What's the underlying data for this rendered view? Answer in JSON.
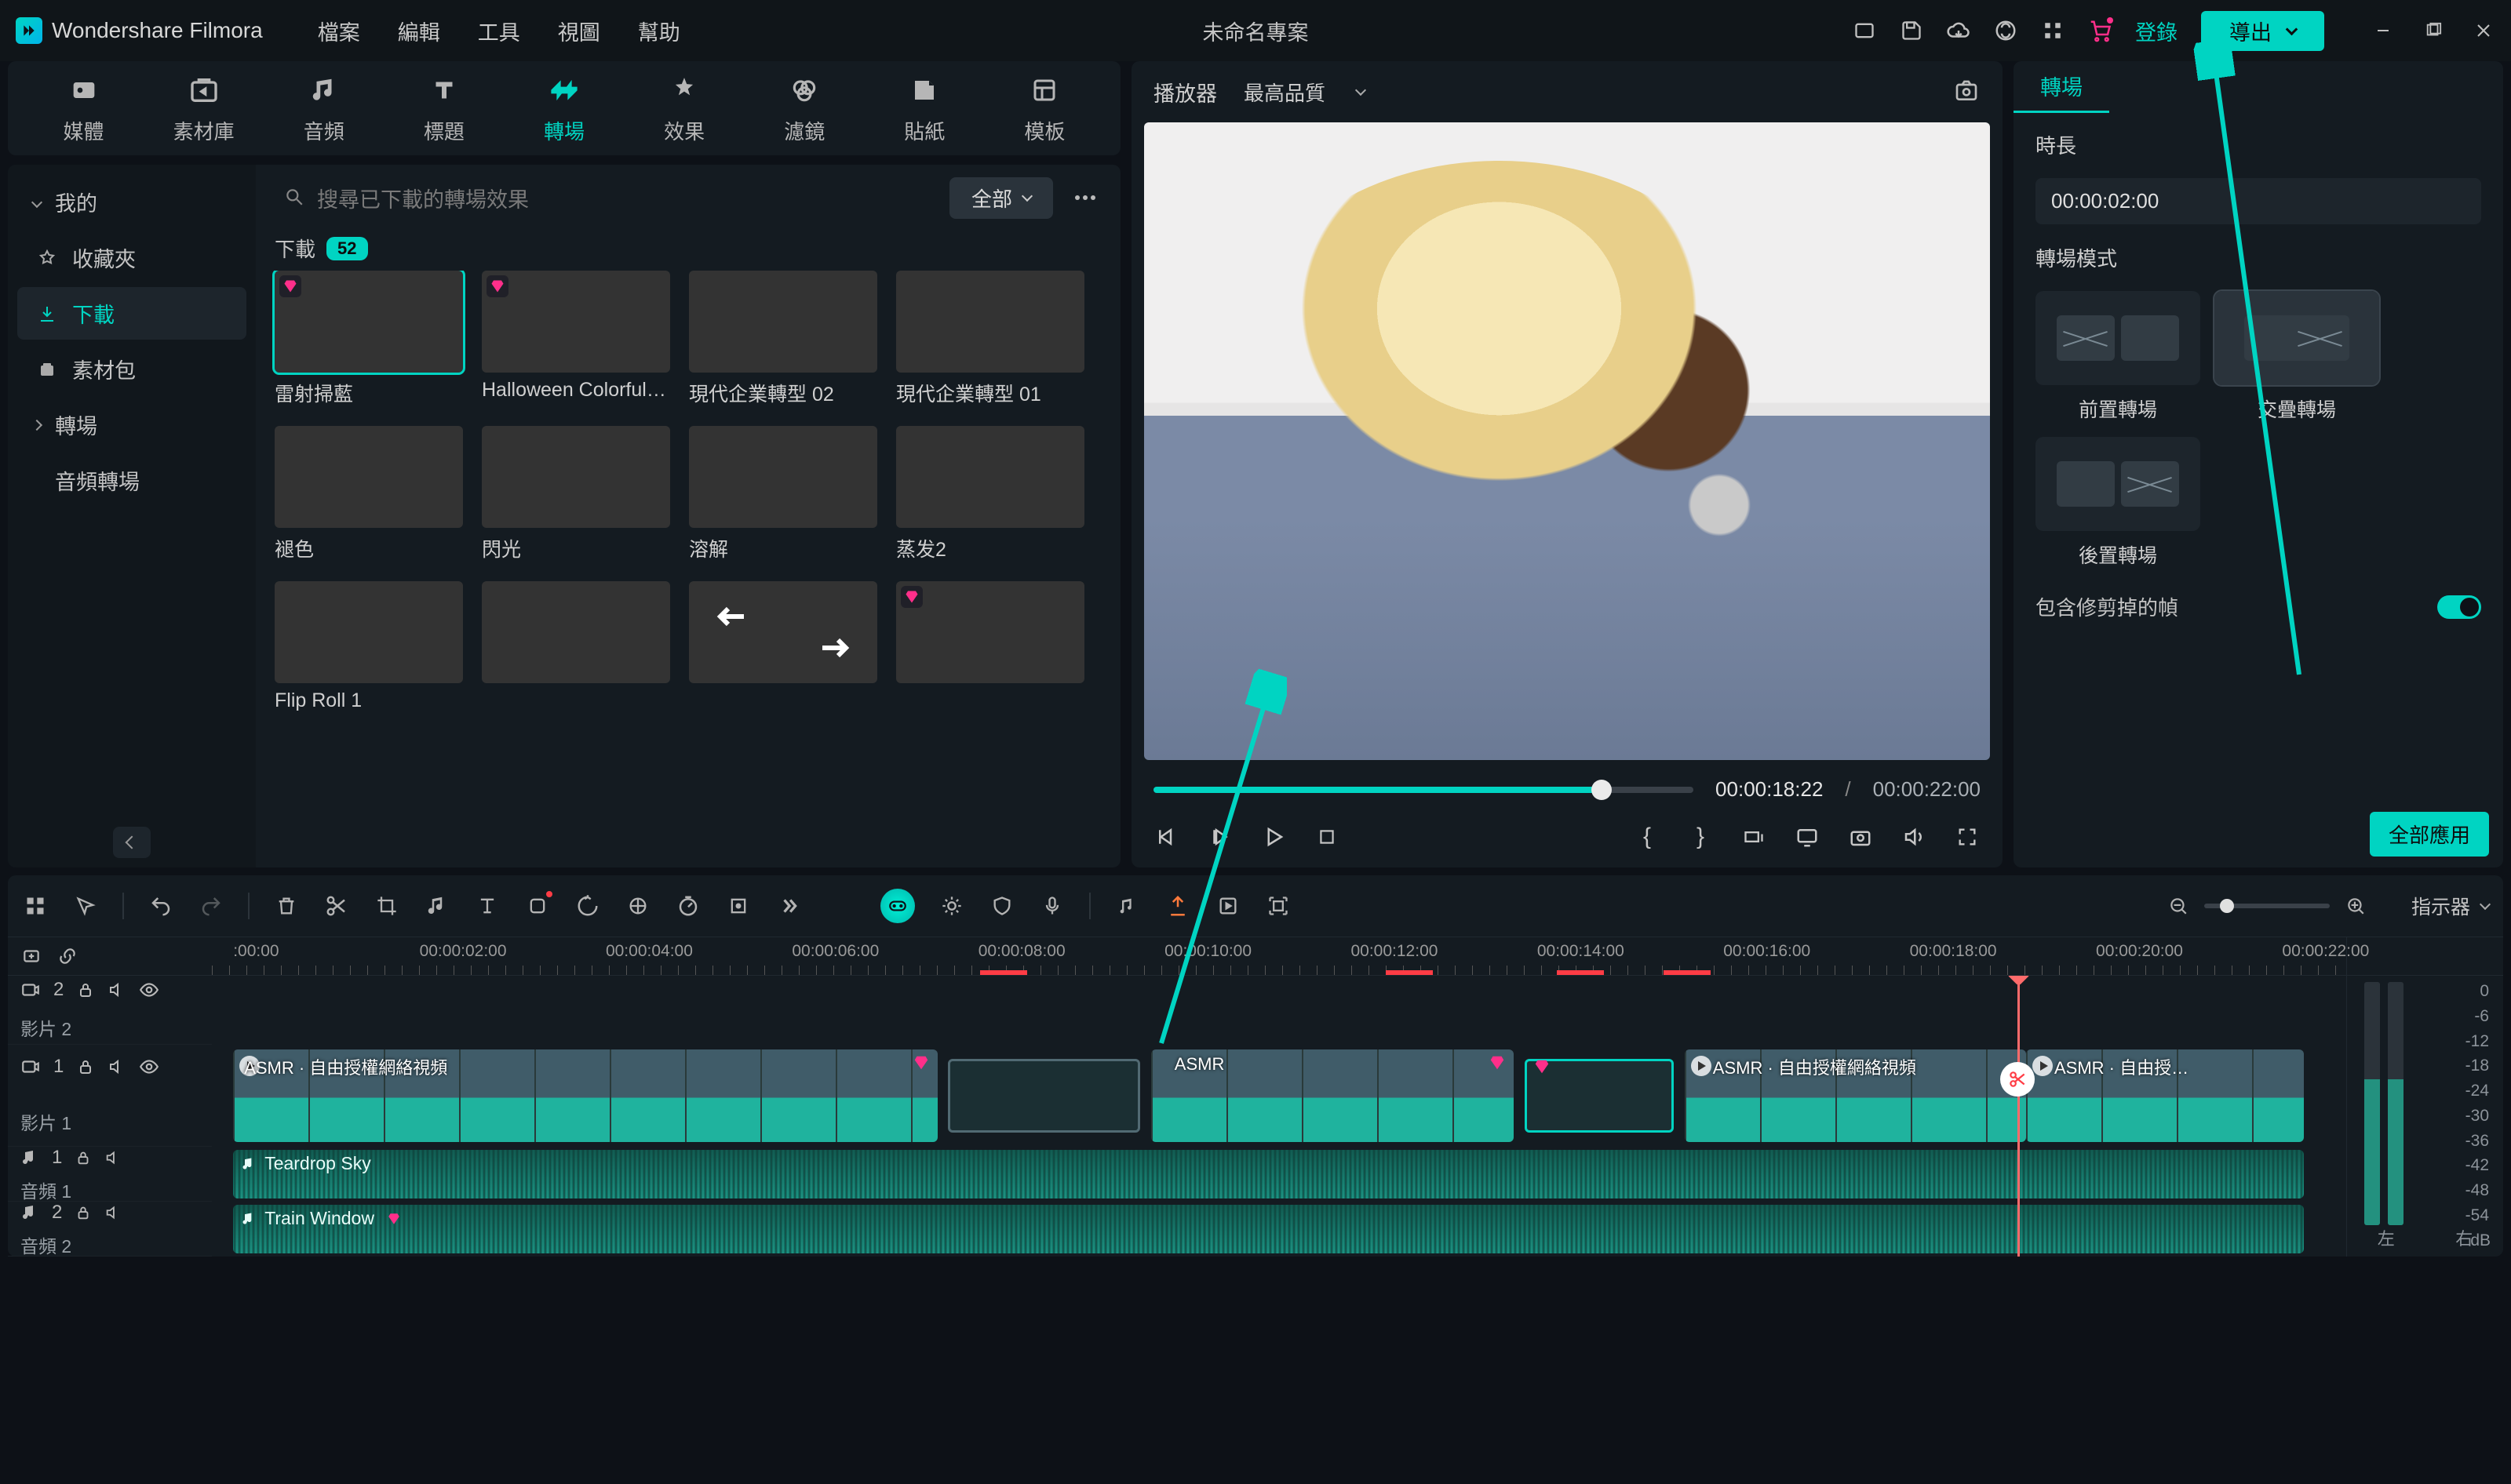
{
  "app_name": "Wondershare Filmora",
  "menu": [
    "檔案",
    "編輯",
    "工具",
    "視圖",
    "幫助"
  ],
  "project_title": "未命名專案",
  "login_label": "登錄",
  "export_label": "導出",
  "category_tabs": [
    {
      "id": "media",
      "label": "媒體"
    },
    {
      "id": "stock",
      "label": "素材庫"
    },
    {
      "id": "audio",
      "label": "音頻"
    },
    {
      "id": "title",
      "label": "標題"
    },
    {
      "id": "transition",
      "label": "轉場",
      "active": true
    },
    {
      "id": "effect",
      "label": "效果"
    },
    {
      "id": "filter",
      "label": "濾鏡"
    },
    {
      "id": "sticker",
      "label": "貼紙"
    },
    {
      "id": "template",
      "label": "模板"
    }
  ],
  "tree": {
    "my_section": "我的",
    "favorites": "收藏夾",
    "downloads": "下載",
    "assets": "素材包",
    "transition_section": "轉場",
    "audio_transition": "音頻轉場"
  },
  "search_placeholder": "搜尋已下載的轉場效果",
  "filter_all": "全部",
  "download_header": "下載",
  "download_count": "52",
  "thumbs": [
    {
      "label": "雷射掃藍",
      "premium": true,
      "cls": "t1",
      "selected": true
    },
    {
      "label": "Halloween Colorful T...",
      "premium": true,
      "cls": "t2"
    },
    {
      "label": "現代企業轉型 02",
      "cls": "t3"
    },
    {
      "label": "現代企業轉型 01",
      "cls": "t4"
    },
    {
      "label": "褪色",
      "cls": "t5"
    },
    {
      "label": "閃光",
      "cls": "t6"
    },
    {
      "label": "溶解",
      "cls": "t7"
    },
    {
      "label": "蒸发2",
      "cls": "t8"
    },
    {
      "label": "Flip Roll 1",
      "cls": "t9"
    },
    {
      "label": "",
      "cls": "t10"
    },
    {
      "label": "",
      "cls": "t11",
      "arrows": true
    },
    {
      "label": "",
      "cls": "t12",
      "premium": true
    }
  ],
  "player": {
    "title": "播放器",
    "quality": "最高品質",
    "current": "00:00:18:22",
    "total": "00:00:22:00"
  },
  "timeline": {
    "indicator_label": "指示器",
    "ruler_start": ":00:00",
    "ruler": [
      "00:00:02:00",
      "00:00:04:00",
      "00:00:06:00",
      "00:00:08:00",
      "00:00:10:00",
      "00:00:12:00",
      "00:00:14:00",
      "00:00:16:00",
      "00:00:18:00",
      "00:00:20:00",
      "00:00:22:00"
    ],
    "tracks": {
      "video2": {
        "name": "影片 2",
        "idx": "2"
      },
      "video1": {
        "name": "影片 1",
        "idx": "1",
        "clip_title": "ASMR · 自由授權網絡視頻"
      },
      "audio1": {
        "name": "音頻 1",
        "idx": "1",
        "clip_title": "Teardrop Sky"
      },
      "audio2": {
        "name": "音頻 2",
        "idx": "2",
        "clip_title": "Train Window"
      }
    },
    "meter": {
      "scale": [
        "0",
        "-6",
        "-12",
        "-18",
        "-24",
        "-30",
        "-36",
        "-42",
        "-48",
        "-54"
      ],
      "left": "左",
      "right": "右",
      "db": "dB"
    }
  },
  "props": {
    "tab": "轉場",
    "duration_label": "時長",
    "duration_value": "00:00:02:00",
    "mode_label": "轉場模式",
    "modes": [
      {
        "id": "pre",
        "label": "前置轉場"
      },
      {
        "id": "cross",
        "label": "交疊轉場",
        "selected": true
      },
      {
        "id": "post",
        "label": "後置轉場"
      }
    ],
    "trim_label": "包含修剪掉的幀",
    "apply_all": "全部應用"
  }
}
